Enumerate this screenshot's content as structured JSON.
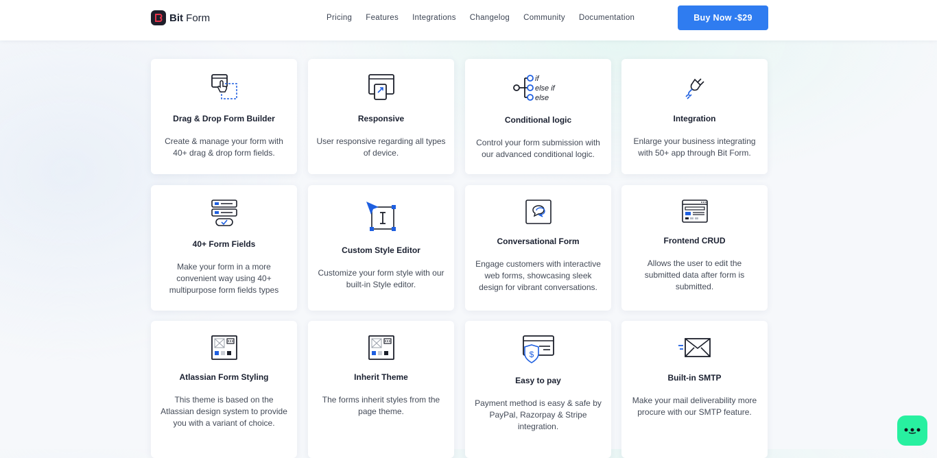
{
  "header": {
    "logo_text_bold": "Bit",
    "logo_text_rest": " Form",
    "nav": [
      "Pricing",
      "Features",
      "Integrations",
      "Changelog",
      "Community",
      "Documentation"
    ],
    "buy_button": "Buy Now -$29"
  },
  "features": [
    {
      "title": "Drag & Drop Form Builder",
      "desc": "Create & manage your form with 40+ drag & drop form fields.",
      "icon": "drag-drop-icon"
    },
    {
      "title": "Responsive",
      "desc": "User responsive regarding all types of device.",
      "icon": "responsive-icon"
    },
    {
      "title": "Conditional logic",
      "desc": "Control your form submission with our advanced conditional logic.",
      "icon": "conditional-logic-icon",
      "icon_labels": [
        "if",
        "else if",
        "else"
      ]
    },
    {
      "title": "Integration",
      "desc": "Enlarge your business integrating with 50+ app through Bit Form.",
      "icon": "plug-icon"
    },
    {
      "title": "40+ Form Fields",
      "desc": "Make your form in a more convenient way using 40+ multipurpose form fields types",
      "icon": "form-fields-icon"
    },
    {
      "title": "Custom Style Editor",
      "desc": "Customize your form style with our built-in Style editor.",
      "icon": "style-editor-icon"
    },
    {
      "title": "Conversational Form",
      "desc": "Engage customers with interactive web forms, showcasing sleek design for vibrant conversations.",
      "icon": "chat-bubble-icon"
    },
    {
      "title": "Frontend CRUD",
      "desc": "Allows the user to edit the submitted data after form is submitted.",
      "icon": "crud-window-icon"
    },
    {
      "title": "Atlassian Form Styling",
      "desc": "This theme is based on the Atlassian design system to provide you with a variant of choice.",
      "icon": "theme-window-icon"
    },
    {
      "title": "Inherit Theme",
      "desc": "The forms inherit styles from the page theme.",
      "icon": "theme-window-icon"
    },
    {
      "title": "Easy to pay",
      "desc": "Payment method is easy & safe by PayPal, Razorpay & Stripe integration.",
      "icon": "payment-card-icon"
    },
    {
      "title": "Built-in SMTP",
      "desc": "Make your mail deliverability more procure with our SMTP feature.",
      "icon": "envelope-icon"
    }
  ],
  "colors": {
    "accent": "#2f7cf0",
    "icon_blue": "#1e5fe0",
    "chat": "#28f0a0"
  }
}
